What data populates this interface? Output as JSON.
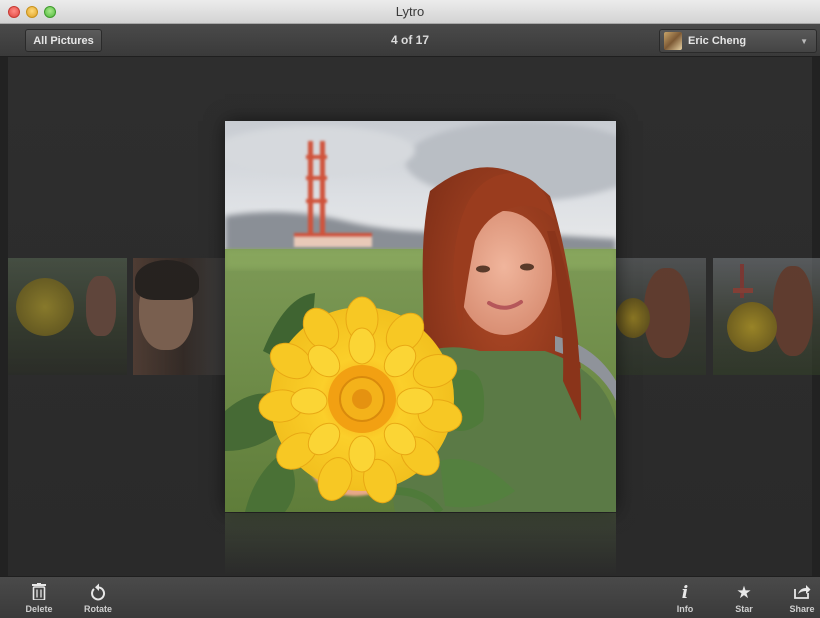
{
  "window": {
    "title": "Lytro"
  },
  "toolbar": {
    "all_pictures_label": "All Pictures",
    "counter": "4 of 17",
    "user": {
      "name": "Eric Cheng"
    }
  },
  "bottom_toolbar": {
    "delete_label": "Delete",
    "rotate_label": "Rotate",
    "info_label": "Info",
    "star_label": "Star",
    "share_label": "Share"
  },
  "icons": {
    "delete": "trash-icon",
    "rotate": "rotate-icon",
    "info": "info-icon",
    "star": "star-icon",
    "share": "share-icon"
  },
  "colors": {
    "stage_bg": "#2b2b2b",
    "toolbar_bg": "#444444",
    "flower": "#f5c21a"
  }
}
